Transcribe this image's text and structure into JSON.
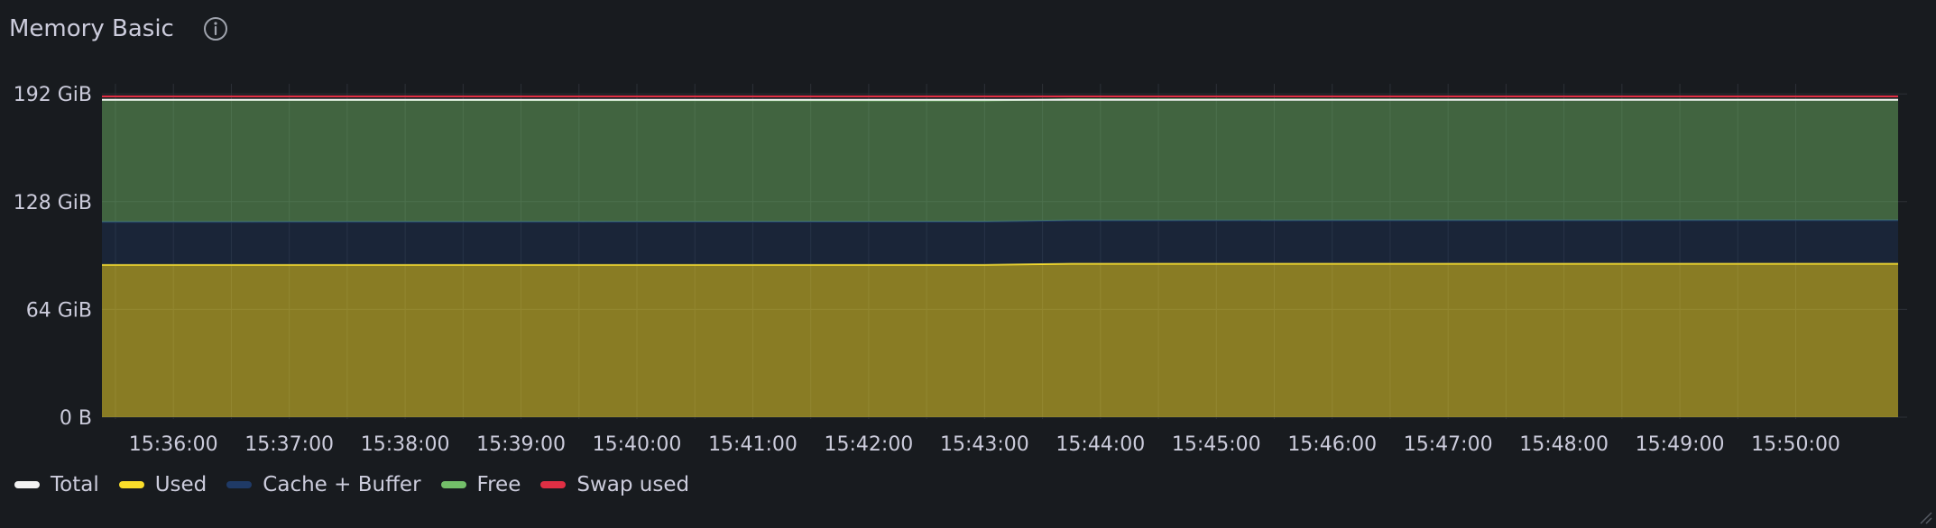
{
  "panel": {
    "title": "Memory Basic",
    "info_icon": "info-circle-icon"
  },
  "colors": {
    "background": "#181b1f",
    "grid": "#2c3037",
    "text": "#ccccdc"
  },
  "chart_data": {
    "type": "area",
    "title": "Memory Basic",
    "unit": "bytes",
    "ylim": [
      0,
      198
    ],
    "y_ticks": [
      {
        "value": 0,
        "label": "0 B"
      },
      {
        "value": 64,
        "label": "64 GiB"
      },
      {
        "value": 128,
        "label": "128 GiB"
      },
      {
        "value": 192,
        "label": "192 GiB"
      }
    ],
    "x_labels": [
      "15:36:00",
      "15:37:00",
      "15:38:00",
      "15:39:00",
      "15:40:00",
      "15:41:00",
      "15:42:00",
      "15:43:00",
      "15:44:00",
      "15:45:00",
      "15:46:00",
      "15:47:00",
      "15:48:00",
      "15:49:00",
      "15:50:00"
    ],
    "x_range": [
      "15:35:23",
      "15:50:53"
    ],
    "grid": true,
    "legend_position": "bottom",
    "series": [
      {
        "name": "Total",
        "color": "#f2f2f2",
        "stack": false,
        "x": [
          "15:35:23",
          "15:50:53"
        ],
        "values": [
          188.5,
          188.5
        ]
      },
      {
        "name": "Used",
        "color": "#fade2a",
        "stack": true,
        "x": [
          "15:35:23",
          "15:43:00",
          "15:43:45",
          "15:50:53"
        ],
        "values": [
          90.5,
          90.5,
          91.2,
          91.2
        ]
      },
      {
        "name": "Cache + Buffer",
        "color": "#1f3a66",
        "stack": true,
        "x": [
          "15:35:23",
          "15:50:53"
        ],
        "values": [
          25.5,
          25.8
        ]
      },
      {
        "name": "Free",
        "color": "#73bf69",
        "stack": true,
        "x": [
          "15:35:23",
          "15:50:53"
        ],
        "values": [
          72.5,
          71.5
        ]
      },
      {
        "name": "Swap used",
        "color": "#e02f44",
        "stack": false,
        "x": [
          "15:35:23",
          "15:50:53"
        ],
        "values": [
          190.5,
          190.5
        ]
      }
    ]
  }
}
